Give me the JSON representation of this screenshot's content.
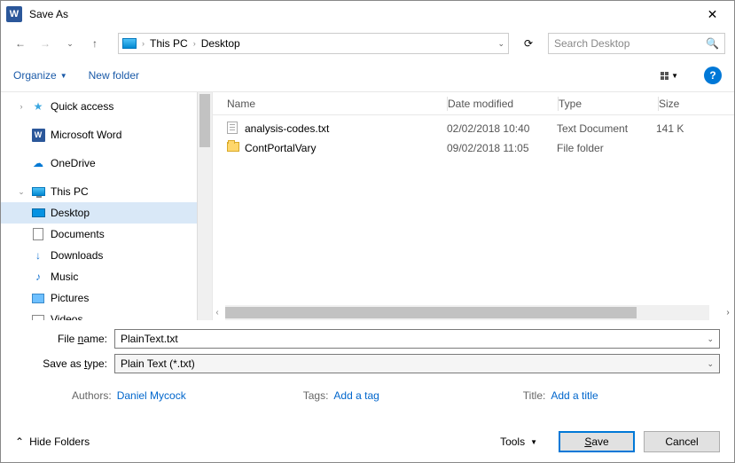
{
  "title": "Save As",
  "breadcrumb": {
    "root": "This PC",
    "leaf": "Desktop"
  },
  "search": {
    "placeholder": "Search Desktop"
  },
  "toolbar": {
    "organize": "Organize",
    "new_folder": "New folder"
  },
  "tree": {
    "quick_access": "Quick access",
    "word": "Microsoft Word",
    "onedrive": "OneDrive",
    "this_pc": "This PC",
    "desktop": "Desktop",
    "documents": "Documents",
    "downloads": "Downloads",
    "music": "Music",
    "pictures": "Pictures",
    "videos": "Videos"
  },
  "columns": {
    "name": "Name",
    "date": "Date modified",
    "type": "Type",
    "size": "Size"
  },
  "rows": [
    {
      "name": "analysis-codes.txt",
      "date": "02/02/2018 10:40",
      "type": "Text Document",
      "size": "141 K",
      "icon": "txt"
    },
    {
      "name": "ContPortalVary",
      "date": "09/02/2018 11:05",
      "type": "File folder",
      "size": "",
      "icon": "folder"
    }
  ],
  "fields": {
    "file_name_label": "File name:",
    "file_name_value": "PlainText.txt",
    "type_label": "Save as type:",
    "type_value": "Plain Text (*.txt)"
  },
  "meta": {
    "authors_label": "Authors:",
    "authors_value": "Daniel Mycock",
    "tags_label": "Tags:",
    "tags_value": "Add a tag",
    "title_label": "Title:",
    "title_value": "Add a title"
  },
  "footer": {
    "hide_folders": "Hide Folders",
    "tools": "Tools",
    "save": "Save",
    "cancel": "Cancel"
  }
}
